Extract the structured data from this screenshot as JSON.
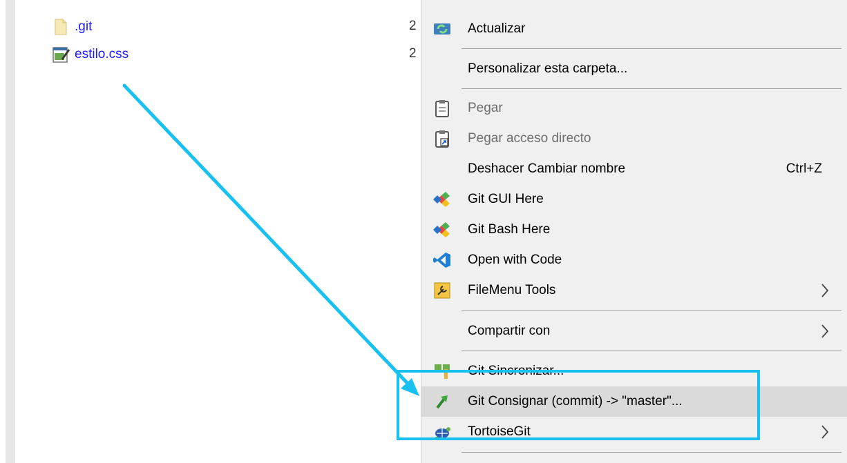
{
  "files": [
    {
      "name": ".git",
      "icon": "folder-doc-icon",
      "col_trunc": "2"
    },
    {
      "name": "estilo.css",
      "icon": "css-file-icon",
      "col_trunc": "2"
    }
  ],
  "menu": {
    "items": [
      {
        "label": "Actualizar",
        "icon": "refresh-icon"
      },
      {
        "label": "Personalizar esta carpeta..."
      },
      {
        "label": "Pegar",
        "icon": "clipboard-icon",
        "disabled": true
      },
      {
        "label": "Pegar acceso directo",
        "icon": "paste-shortcut-icon",
        "disabled": true
      },
      {
        "label": "Deshacer Cambiar nombre",
        "shortcut": "Ctrl+Z"
      },
      {
        "label": "Git GUI Here",
        "icon": "git-icon"
      },
      {
        "label": "Git Bash Here",
        "icon": "git-icon"
      },
      {
        "label": "Open with Code",
        "icon": "vscode-icon"
      },
      {
        "label": "FileMenu Tools",
        "icon": "filemenu-icon",
        "submenu": true
      },
      {
        "label": "Compartir con",
        "submenu": true
      },
      {
        "label": "Git Sincronizar...",
        "icon": "git-sync-icon"
      },
      {
        "label": "Git Consignar (commit) -> \"master\"...",
        "icon": "git-commit-icon",
        "highlighted": true
      },
      {
        "label": "TortoiseGit",
        "icon": "tortoisegit-icon",
        "submenu": true
      }
    ]
  },
  "colors": {
    "callout": "#19c1f0",
    "link": "#1a1aff",
    "menu_bg": "#f0f0f0",
    "highlight_bg": "#dadada"
  }
}
